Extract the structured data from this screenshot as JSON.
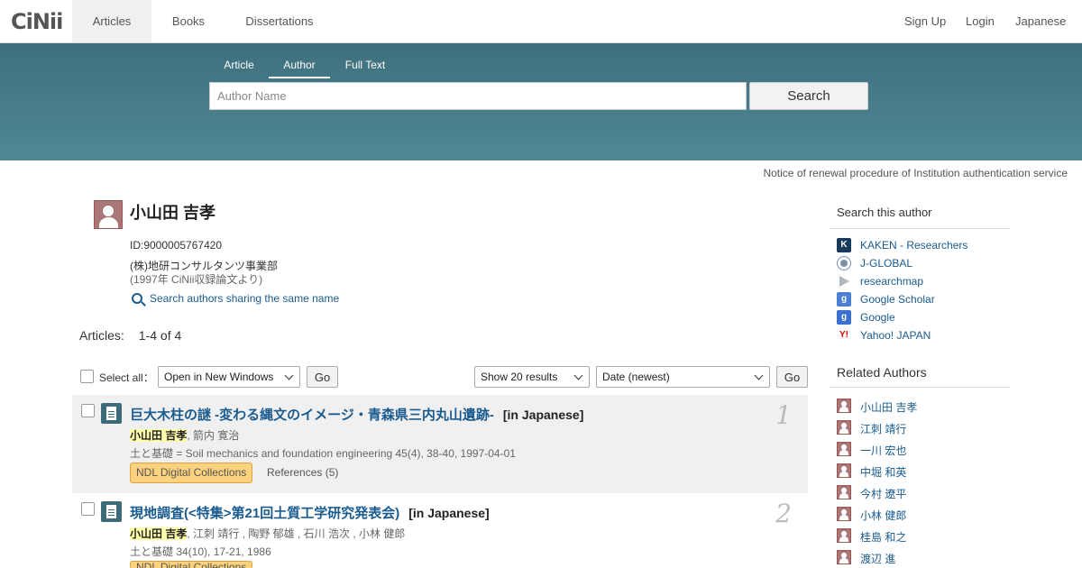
{
  "topnav": {
    "logo": "CiNii",
    "tabs": [
      {
        "label": "Articles"
      },
      {
        "label": "Books"
      },
      {
        "label": "Dissertations"
      }
    ],
    "right": [
      {
        "label": "Sign Up"
      },
      {
        "label": "Login"
      },
      {
        "label": "Japanese"
      }
    ]
  },
  "search": {
    "tabs": [
      {
        "label": "Article"
      },
      {
        "label": "Author"
      },
      {
        "label": "Full Text"
      }
    ],
    "placeholder": "Author Name",
    "button": "Search"
  },
  "notice": "Notice of renewal procedure of Institution authentication service",
  "author": {
    "name": "小山田 吉孝",
    "id": "ID:9000005767420",
    "affiliation": "(株)地研コンサルタンツ事業部",
    "affiliation_note": "(1997年 CiNii収録論文より)",
    "same_name_link": "Search authors sharing the same name"
  },
  "articles": {
    "label": "Articles:",
    "count": "1-4 of 4"
  },
  "controls": {
    "select_all": "Select all：",
    "open_option": "Open in New Windows",
    "go": "Go",
    "show_option": "Show 20 results",
    "sort_option": "Date (newest)"
  },
  "results": [
    {
      "num": "1",
      "title": "巨大木柱の謎 -変わる縄文のイメージ・青森県三内丸山遺跡-",
      "tag": "[in Japanese]",
      "author_hl": "小山田 吉孝",
      "authors_rest": ", 箭内 寛治",
      "source": "土と基礎 = Soil mechanics and foundation engineering 45(4), 38-40, 1997-04-01",
      "ndl": "NDL Digital Collections",
      "refs": "References (5)"
    },
    {
      "num": "2",
      "title": "現地調査(<特集>第21回土質工学研究発表会)",
      "tag": "[in Japanese]",
      "author_hl": "小山田 吉孝",
      "authors_rest": ", 江刺 靖行 , 陶野 郁雄 , 石川 浩次 , 小林 健郎",
      "source": "土と基礎 34(10), 17-21, 1986",
      "ndl": "NDL Digital Collections",
      "refs": ""
    }
  ],
  "sidebar": {
    "search_title": "Search this author",
    "search_links": [
      {
        "label": "KAKEN - Researchers",
        "icon": "kaken-icon",
        "color": "#1a3a5c"
      },
      {
        "label": "J-GLOBAL",
        "icon": "jglobal-icon",
        "color": "#7a8fa8"
      },
      {
        "label": "researchmap",
        "icon": "researchmap-icon",
        "color": "#b0b8c0"
      },
      {
        "label": "Google Scholar",
        "icon": "google-scholar-icon",
        "color": "#4a7fd4"
      },
      {
        "label": "Google",
        "icon": "google-icon",
        "color": "#3a6fd0"
      },
      {
        "label": "Yahoo! JAPAN",
        "icon": "yahoo-icon",
        "color": "#d00"
      }
    ],
    "related_title": "Related Authors",
    "related": [
      {
        "name": "小山田 吉孝"
      },
      {
        "name": "江刺 靖行"
      },
      {
        "name": "一川 宏也"
      },
      {
        "name": "中堀 和英"
      },
      {
        "name": "今村 遼平"
      },
      {
        "name": "小林 健郎"
      },
      {
        "name": "桂島 和之"
      },
      {
        "name": "渡辺 進"
      }
    ]
  }
}
